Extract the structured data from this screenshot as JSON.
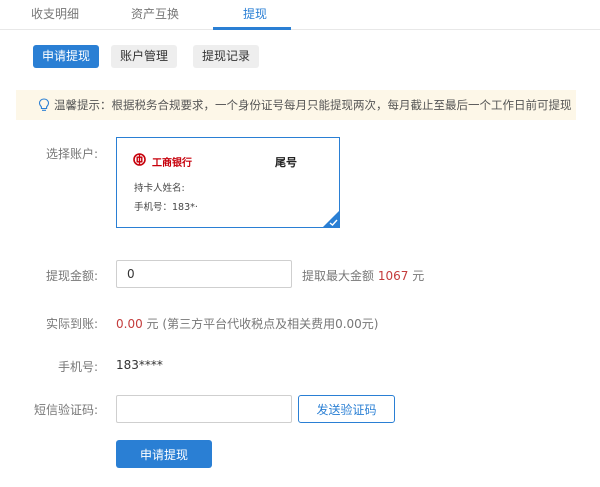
{
  "top_tabs": [
    "收支明细",
    "资产互换",
    "提现"
  ],
  "sub_tabs": [
    "申请提现",
    "账户管理",
    "提现记录"
  ],
  "tip": {
    "text": "温馨提示：根据税务合规要求，一个身份证号每月只能提现两次，每月截止至最后一个工作日前可提现"
  },
  "form": {
    "account_label": "选择账户:",
    "amount_label": "提现金额:",
    "actual_label": "实际到账:",
    "phone_label": "手机号:",
    "sms_label": "短信验证码:"
  },
  "account": {
    "bank_name": "工商银行",
    "tail_label": "尾号",
    "holder": "持卡人姓名:",
    "phone": "手机号：183*·"
  },
  "amount": {
    "value": "0",
    "max_prefix": "提取最大金额",
    "max_value": "1067",
    "max_unit": "元"
  },
  "actual": {
    "value": "0.00",
    "unit": "元",
    "note": "(第三方平台代收税点及相关费用0.00元)"
  },
  "phone": {
    "value": "183****"
  },
  "sms": {
    "value": "",
    "send_label": "发送验证码"
  },
  "submit_label": "申请提现",
  "colors": {
    "primary": "#2a7fd4",
    "red": "#c43c3c",
    "tip_bg": "#fdf7e8",
    "bank_red": "#c7000b"
  }
}
